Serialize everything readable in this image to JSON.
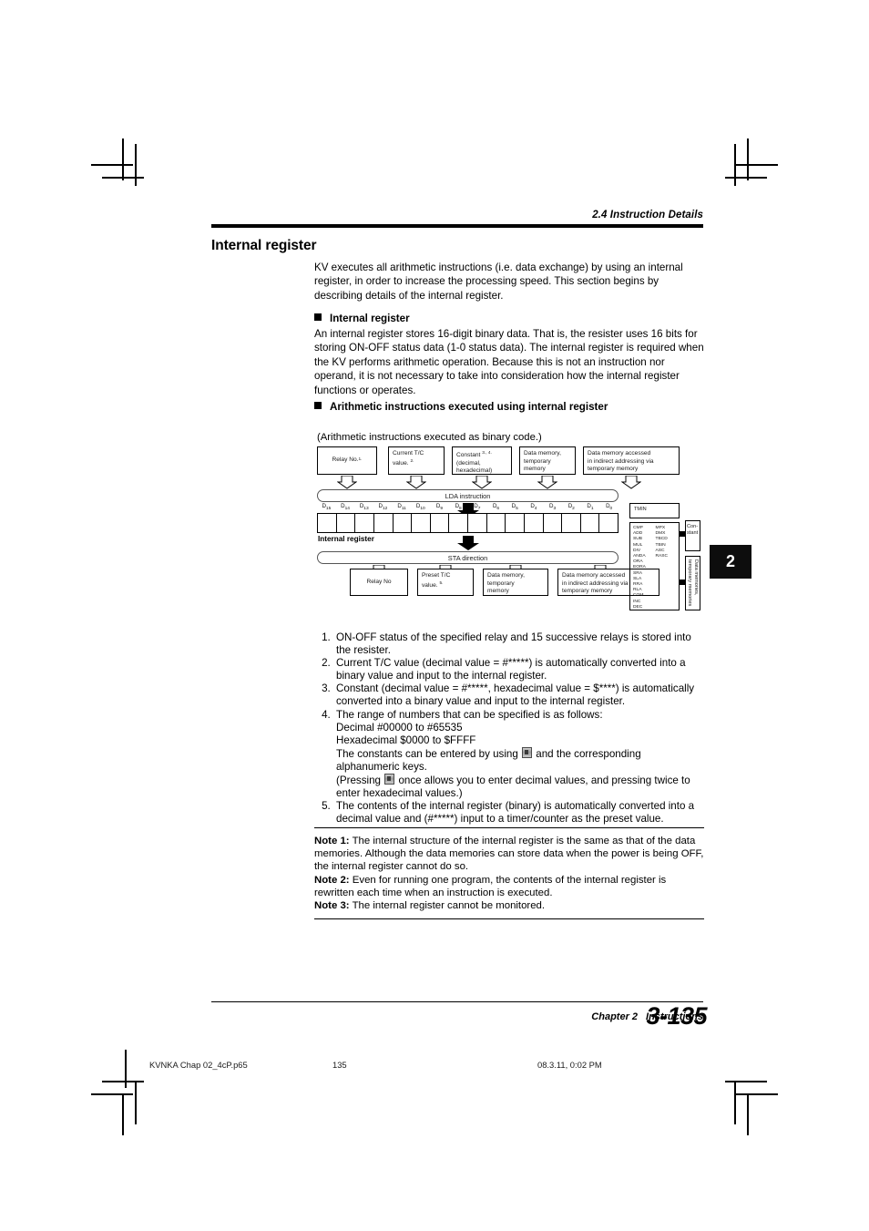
{
  "header": {
    "running_head": "2.4 Instruction Details"
  },
  "section": {
    "title": "Internal register",
    "intro": "KV executes all arithmetic instructions (i.e. data exchange) by using an internal register, in order to increase the processing speed. This section begins by describing details of the internal register."
  },
  "subsections": [
    {
      "heading": "Internal register",
      "body": "An internal register stores 16-digit binary data. That is, the resister uses 16 bits for storing ON-OFF status data (1-0 status data). The internal register is required when the KV performs arithmetic operation. Because this is not an instruction nor operand, it is not necessary to take into consideration how the internal register functions or operates."
    },
    {
      "heading": "Arithmetic instructions executed using internal register",
      "body": ""
    }
  ],
  "diagram": {
    "caption": "(Arithmetic instructions executed as binary code.)",
    "sources": [
      {
        "name": "source-relay",
        "line1": "Relay No.",
        "sup": "1."
      },
      {
        "name": "source-current-tc",
        "line1": "Current T/C",
        "line2": "value.",
        "sup": "2."
      },
      {
        "name": "source-constant",
        "line1": "Constant",
        "sup": "3., 4.",
        "line2": "(decimal,",
        "line3": "hexadecimal)"
      },
      {
        "name": "source-data-memory",
        "line1": "Data memory,",
        "line2": "temporary",
        "line3": "memory"
      },
      {
        "name": "source-indirect",
        "line1": "Data memory accessed",
        "line2": "in indirect addressing via",
        "line3": "temporary memory"
      }
    ],
    "lda_label": "LDA instruction",
    "sta_label": "STA direction",
    "register_caption": "Internal register",
    "register_bits": [
      "D15",
      "D14",
      "D13",
      "D12",
      "D11",
      "D10",
      "D9",
      "D8",
      "D7",
      "D6",
      "D5",
      "D4",
      "D3",
      "D2",
      "D1",
      "D0"
    ],
    "destinations": [
      {
        "name": "dest-relay",
        "line1": "Relay No"
      },
      {
        "name": "dest-preset-tc",
        "line1": "Preset T/C",
        "line2": "value.",
        "sup": "5."
      },
      {
        "name": "dest-data-memory",
        "line1": "Data memory,",
        "line2": "temporary",
        "line3": "memory"
      },
      {
        "name": "dest-indirect",
        "line1": "Data memory accessed",
        "line2": "in indirect addressing via",
        "line3": "temporary memory"
      }
    ],
    "panel": {
      "tmin_label": "TMIN",
      "instructions_col1": [
        "CMP",
        "ADD",
        "SUB",
        "MUL",
        "DIV",
        "ANDA",
        "ORA",
        "EORA",
        "SRA",
        "SLA",
        "RRA",
        "RLA",
        "COM",
        "INC",
        "DEC"
      ],
      "instructions_col2": [
        "MPX",
        "DMX",
        "TBCD",
        "TBIN",
        "ASC",
        "RASC"
      ],
      "constant_label": "Con-stant",
      "data_memories_label": "Data memories, temporary memories"
    }
  },
  "numbered_list": [
    {
      "text": "ON-OFF status of the specified relay and 15 successive relays is stored into the resister."
    },
    {
      "text": "Current T/C value (decimal value = #*****) is automatically converted into a binary value and input to the internal register."
    },
    {
      "text": "Constant (decimal value = #*****, hexadecimal value = $****) is automatically converted into a binary value and input to the internal register."
    },
    {
      "text": "The range of numbers that can be specified is as follows:",
      "sub_lines": [
        "Decimal #00000 to #65535",
        "Hexadecimal $0000 to $FFFF"
      ],
      "text_with_icon_a_before": "The constants can be entered by using",
      "text_with_icon_a_after": "and the corresponding alphanumeric keys.",
      "text_with_icon_b_before": "(Pressing",
      "text_with_icon_b_after": "once allows you to enter decimal values, and pressing twice to enter hexadecimal values.)"
    },
    {
      "text": "The contents of the internal register (binary) is automatically converted into a decimal value and (#*****) input to a timer/counter as the preset value."
    }
  ],
  "icons": {
    "key_icon": "key-icon"
  },
  "notes": [
    {
      "label": "Note 1:",
      "text": "The internal structure of the internal register is the same as that of the data memories. Although the data memories can store data when the power is being OFF, the internal register cannot do so."
    },
    {
      "label": "Note 2:",
      "text": "Even for running one program, the contents of the internal register is rewritten each time when an instruction is executed."
    },
    {
      "label": "Note 3:",
      "text": "The internal register cannot be monitored."
    }
  ],
  "chapter_tab": {
    "number": "2"
  },
  "footer": {
    "chapter": "Chapter 2",
    "title": "Instructions",
    "page_number": "3-135"
  },
  "print_slug": {
    "file": "KVNKA Chap 02_4cP.p65",
    "page": "135",
    "date": "08.3.11, 0:02 PM"
  }
}
